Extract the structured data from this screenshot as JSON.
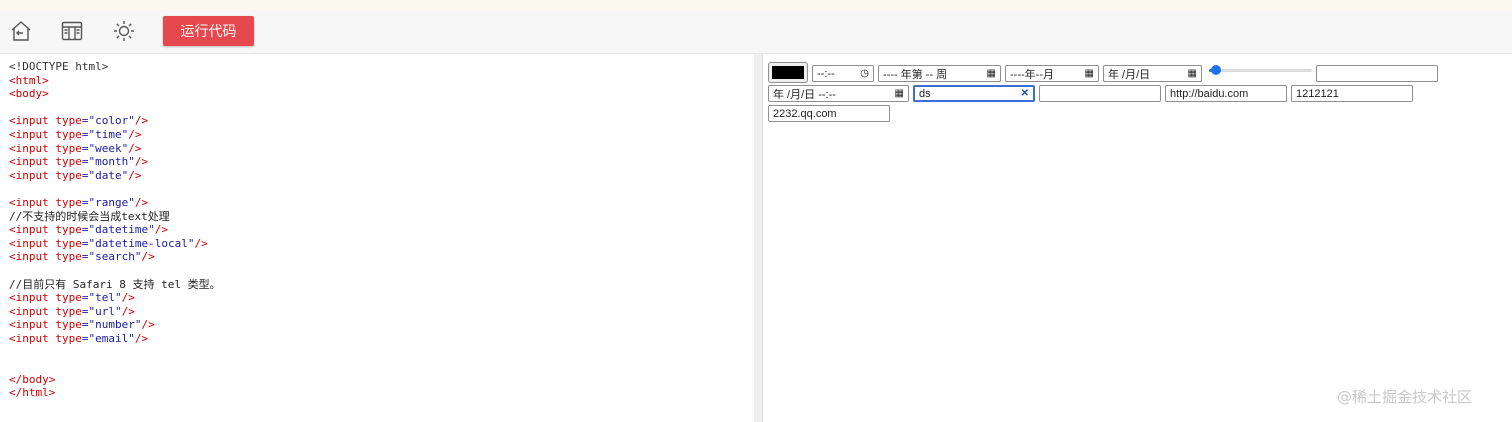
{
  "toolbar": {
    "icons": [
      "home-back-icon",
      "layout-window-icon",
      "brightness-sun-icon"
    ],
    "run_label": "运行代码",
    "run_color": "#e5484d"
  },
  "editor": {
    "lines": [
      "<!DOCTYPE html>",
      "<html>",
      "<body>",
      "",
      "<input type=\"color\"/>",
      "<input type=\"time\"/>",
      "<input type=\"week\"/>",
      "<input type=\"month\"/>",
      "<input type=\"date\"/>",
      "",
      "<input type=\"range\"/>",
      "//不支持的时候会当成text处理",
      "<input type=\"datetime\"/>",
      "<input type=\"datetime-local\"/>",
      "<input type=\"search\"/>",
      "",
      "//目前只有 Safari 8 支持 tel 类型。",
      "<input type=\"tel\"/>",
      "<input type=\"url\"/>",
      "<input type=\"number\"/>",
      "<input type=\"email\"/>",
      "",
      "",
      "</body>",
      "</html>"
    ]
  },
  "preview": {
    "color_value": "#000000",
    "time_text": "--:-- ",
    "week_text": "---- 年第 -- 周",
    "month_text": "----年--月",
    "date_text": "年 /月/日",
    "range_value": 0.0,
    "datetime_text": "",
    "datetime_local_text": "年 /月/日 --:--",
    "search_value": "ds",
    "tel_value": "",
    "url_value": "http://baidu.com",
    "number_value": "1212121",
    "email_value": "2232.qq.com"
  },
  "watermark": "@稀土掘金技术社区"
}
